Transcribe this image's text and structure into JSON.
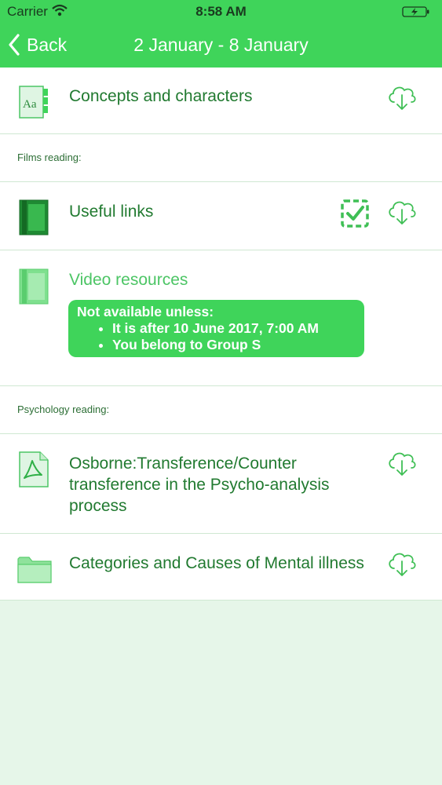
{
  "status_bar": {
    "carrier": "Carrier",
    "time": "8:58 AM"
  },
  "nav": {
    "back_label": "Back",
    "title": "2 January - 8 January"
  },
  "sections": {
    "films_header": "Films reading:",
    "psychology_header": "Psychology reading:"
  },
  "items": {
    "concepts": {
      "title": "Concepts and characters",
      "icon": "glossary-icon"
    },
    "useful_links": {
      "title": "Useful links",
      "icon": "book-icon",
      "completed": true
    },
    "video_resources": {
      "title": "Video resources",
      "icon": "book-icon",
      "restriction_title": "Not available unless:",
      "conditions": [
        "It is after 10 June 2017, 7:00 AM",
        "You belong to Group S"
      ]
    },
    "osborne": {
      "title_lines": [
        "Osborne:Transference/Counter",
        "transference in the Psycho-analysis",
        "process"
      ],
      "icon": "pdf-icon"
    },
    "categories": {
      "title": "Categories and Causes of Mental illness",
      "icon": "folder-icon"
    }
  },
  "colors": {
    "accent": "#3fd45a",
    "text_dark_green": "#217a30",
    "text_muted_green": "#4cc565",
    "background": "#e6f6e9"
  }
}
